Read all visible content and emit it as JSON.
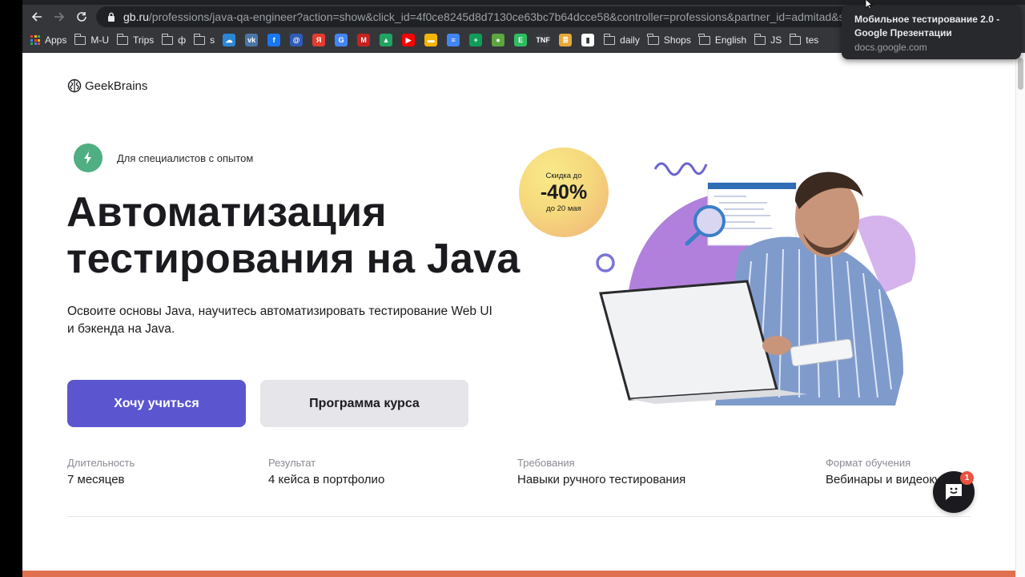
{
  "browser": {
    "url_host": "gb.ru",
    "url_path": "/professions/java-qa-engineer?action=show&click_id=4f0ce8245d8d7130ce63bc7b64dcce58&controller=professions&partner_id=admitad&slug=java-",
    "bookmarks": [
      {
        "type": "apps",
        "label": "Apps"
      },
      {
        "type": "folder",
        "label": "M-U"
      },
      {
        "type": "folder",
        "label": "Trips"
      },
      {
        "type": "folder",
        "label": "ф"
      },
      {
        "type": "folder",
        "label": "s"
      }
    ],
    "favicons": [
      {
        "name": "onedrive",
        "color": "#2b86d6",
        "glyph": "☁"
      },
      {
        "name": "vk",
        "color": "#4a76a8",
        "glyph": "vk"
      },
      {
        "name": "facebook",
        "color": "#1877f2",
        "glyph": "f"
      },
      {
        "name": "mail-ru",
        "color": "#2f5bb7",
        "glyph": "@"
      },
      {
        "name": "yandex",
        "color": "#e33b2e",
        "glyph": "Я"
      },
      {
        "name": "google-translate",
        "color": "#4285f4",
        "glyph": "G"
      },
      {
        "name": "gmail",
        "color": "#c5221f",
        "glyph": "M"
      },
      {
        "name": "google-drive",
        "color": "#1fa463",
        "glyph": "▲"
      },
      {
        "name": "youtube",
        "color": "#ff0000",
        "glyph": "▶"
      },
      {
        "name": "google-slides",
        "color": "#f4b400",
        "glyph": "▬"
      },
      {
        "name": "google-docs",
        "color": "#4285f4",
        "glyph": "≡"
      },
      {
        "name": "google-sheets",
        "color": "#0f9d58",
        "glyph": "+"
      },
      {
        "name": "green-circle-app",
        "color": "#5ba83e",
        "glyph": "●"
      },
      {
        "name": "evernote",
        "color": "#2dbe60",
        "glyph": "E"
      },
      {
        "name": "tnf",
        "color": "#3a3b3e",
        "glyph": "TNF"
      },
      {
        "name": "stack-app",
        "color": "#e8a838",
        "glyph": "≣"
      },
      {
        "name": "trello-like",
        "color": "#ffffff",
        "glyph": "▮"
      }
    ],
    "bookmarks_right": [
      {
        "type": "folder",
        "label": "daily"
      },
      {
        "type": "folder",
        "label": "Shops"
      },
      {
        "type": "folder",
        "label": "English"
      },
      {
        "type": "folder",
        "label": "JS"
      },
      {
        "type": "folder",
        "label": "tes"
      }
    ],
    "tooltip": {
      "title": "Мобильное тестирование 2.0 - Google Презентации",
      "url": "docs.google.com"
    }
  },
  "page": {
    "logo": "GeekBrains",
    "badge": "Для специалистов с опытом",
    "title_line1": "Автоматизация",
    "title_line2": "тестирования на Java",
    "subtitle_line1": "Освоите основы Java, научитесь автоматизировать тестирование Web UI",
    "subtitle_line2": "и бэкенда на Java.",
    "promo": {
      "top": "Скидка до",
      "big": "-40%",
      "bottom": "до 20 мая"
    },
    "buttons": {
      "primary": "Хочу учиться",
      "secondary": "Программа курса"
    },
    "facts": [
      {
        "label": "Длительность",
        "value": "7 месяцев"
      },
      {
        "label": "Результат",
        "value": "4 кейса в портфолио"
      },
      {
        "label": "Требования",
        "value": "Навыки ручного тестирования"
      },
      {
        "label": "Формат обучения",
        "value": "Вебинары и видеокурсы"
      }
    ],
    "chat": {
      "unread": "1"
    }
  },
  "colors": {
    "primary": "#5b56cf",
    "secondary": "#e6e6ea",
    "accent_green": "#4fae82",
    "footer_orange": "#e07150",
    "chat_badge": "#e9533f"
  }
}
